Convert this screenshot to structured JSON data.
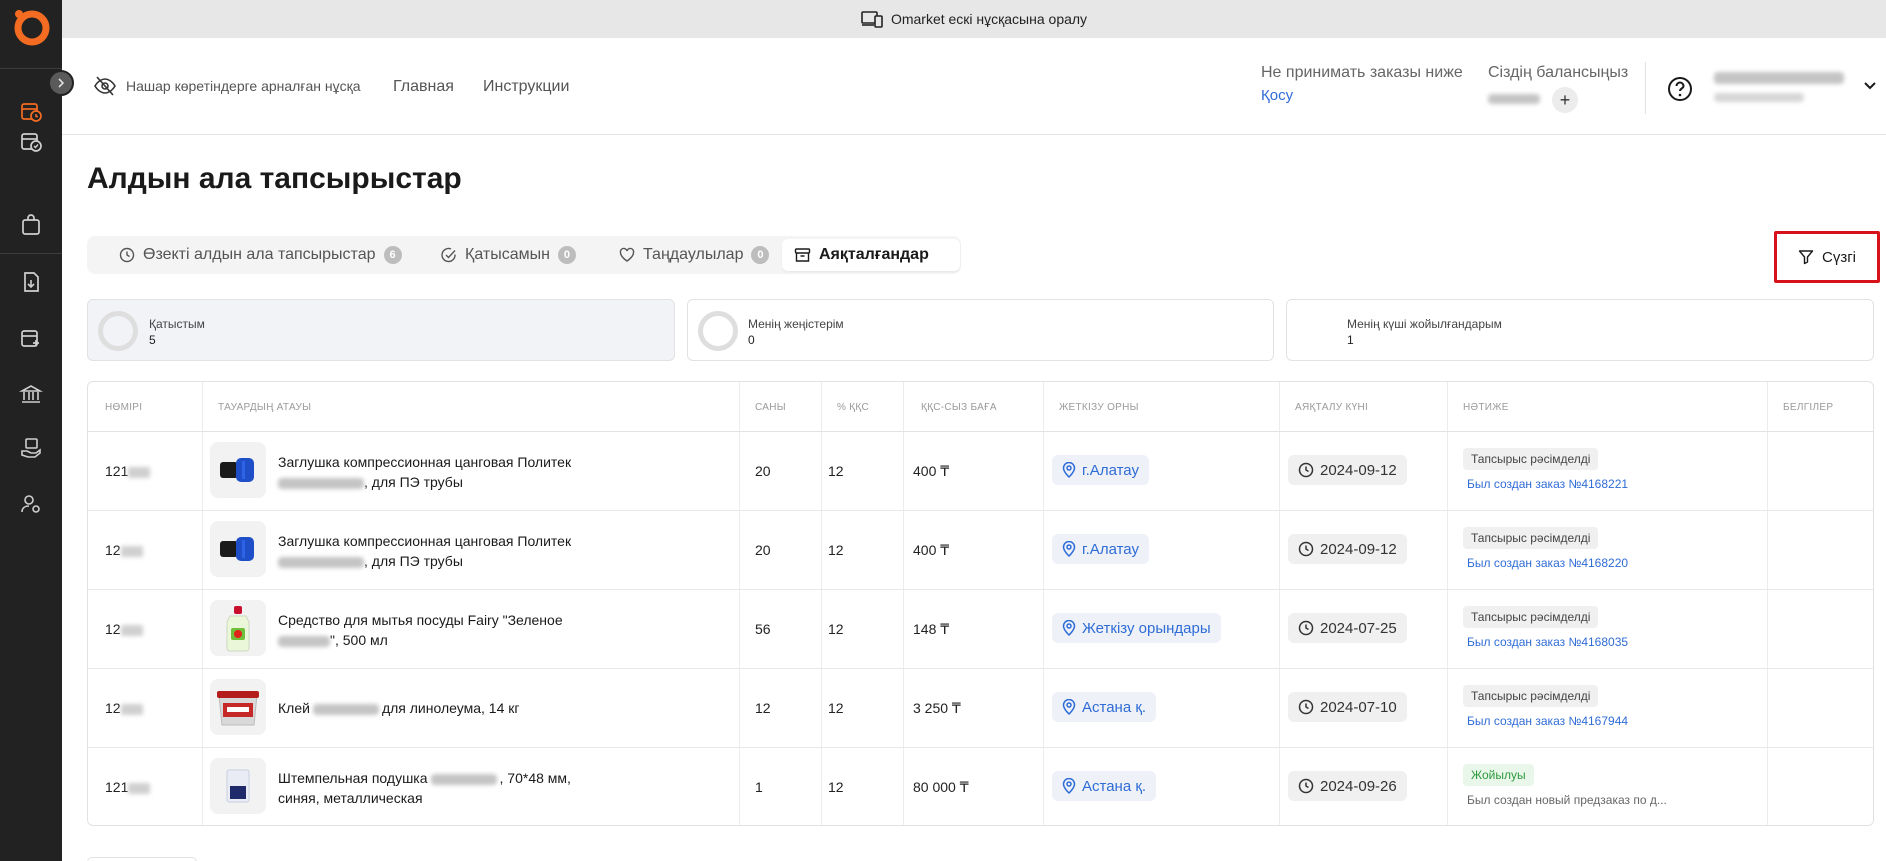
{
  "banner": {
    "text": "Omarket ескі нұсқасына оралу",
    "icon": "devices-icon"
  },
  "header": {
    "a11y_label": "Нашар көретіндерге арналған нұсқа",
    "nav": [
      "Главная",
      "Инструкции"
    ],
    "min_order_label": "Не принимать заказы ниже",
    "min_order_action": "Қосу",
    "balance_label": "Сіздің балансыңыз",
    "plus": "+"
  },
  "page": {
    "title": "Алдын ала тапсырыстар",
    "tabs": [
      {
        "label": "Өзекті алдын ала тапсырыстар",
        "count": "6",
        "icon": "clock-icon"
      },
      {
        "label": "Қатысамын",
        "count": "0",
        "icon": "check-circle-icon"
      },
      {
        "label": "Таңдаулылар",
        "count": "0",
        "icon": "heart-icon"
      },
      {
        "label": "Аяқталғандар",
        "count": "",
        "icon": "archive-icon"
      }
    ],
    "filter_label": "Сүзгі"
  },
  "stats": [
    {
      "label": "Қатыстым",
      "value": "5"
    },
    {
      "label": "Менің жеңістерім",
      "value": "0"
    },
    {
      "label": "Менің күші жойылғандарым",
      "value": "1"
    }
  ],
  "table": {
    "columns": [
      "НӨМІРІ",
      "ТАУАРДЫҢ АТАУЫ",
      "САНЫ",
      "% ҚҚС",
      "ҚҚС-СЫЗ БАҒА",
      "ЖЕТКІЗУ ОРНЫ",
      "АЯҚТАЛУ КҮНІ",
      "НӘТИЖЕ",
      "БЕЛГІЛЕР"
    ],
    "rows": [
      {
        "num": "121",
        "name_a": "Заглушка компрессионная цанговая Политек",
        "name_b": ", для ПЭ трубы",
        "qty": "20",
        "vat": "12",
        "price": "400 ₸",
        "location": "г.Алатау",
        "date": "2024-09-12",
        "status": "Тапсырыс рәсімделді",
        "note": "Был создан заказ №4168221"
      },
      {
        "num": "12",
        "name_a": "Заглушка компрессионная цанговая Политек",
        "name_b": ", для ПЭ трубы",
        "qty": "20",
        "vat": "12",
        "price": "400 ₸",
        "location": "г.Алатау",
        "date": "2024-09-12",
        "status": "Тапсырыс рәсімделді",
        "note": "Был создан заказ №4168220"
      },
      {
        "num": "12",
        "name_a": "Средство для мытья посуды Fairy \"Зеленое",
        "name_b": "\", 500 мл",
        "qty": "56",
        "vat": "12",
        "price": "148 ₸",
        "location": "Жеткізу орындары",
        "date": "2024-07-25",
        "status": "Тапсырыс рәсімделді",
        "note": "Был создан заказ №4168035"
      },
      {
        "num": "12",
        "name_a": "Клей",
        "name_b": "для линолеума, 14 кг",
        "qty": "12",
        "vat": "12",
        "price": "3 250 ₸",
        "location": "Астана қ.",
        "date": "2024-07-10",
        "status": "Тапсырыс рәсімделді",
        "note": "Был создан заказ №4167944"
      },
      {
        "num": "121",
        "name_a": "Штемпельная подушка",
        "name_b": ", 70*48 мм,",
        "name_c": "синяя, металлическая",
        "qty": "1",
        "vat": "12",
        "price": "80 000 ₸",
        "location": "Астана қ.",
        "date": "2024-09-26",
        "status": "Жойылуы",
        "note": "Был создан новый предзаказ по д..."
      }
    ]
  },
  "colors": {
    "accent": "#2f6cd6",
    "sidebar": "#222222",
    "brand": "#f36c21",
    "highlight": "#d8121b"
  }
}
